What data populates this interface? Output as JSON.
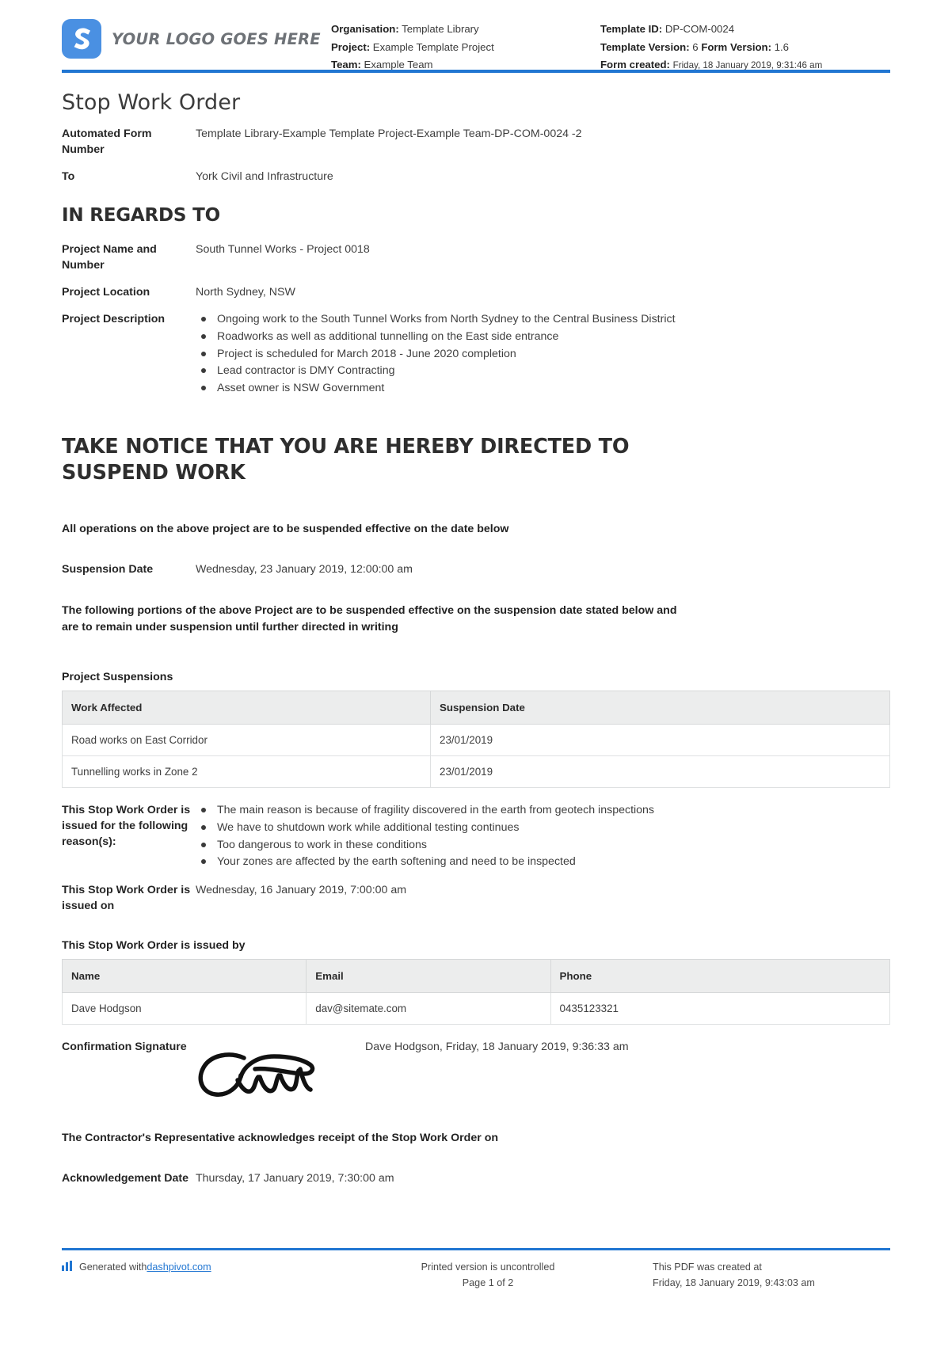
{
  "header": {
    "logo_text": "YOUR LOGO GOES HERE",
    "organisation_label": "Organisation:",
    "organisation_value": "Template Library",
    "project_label": "Project:",
    "project_value": "Example Template Project",
    "team_label": "Team:",
    "team_value": "Example Team",
    "template_id_label": "Template ID:",
    "template_id_value": "DP-COM-0024",
    "template_version_label": "Template Version:",
    "template_version_value": "6",
    "form_version_label": "Form Version:",
    "form_version_value": "1.6",
    "form_created_label": "Form created:",
    "form_created_value": "Friday, 18 January 2019, 9:31:46 am"
  },
  "document": {
    "title": "Stop Work Order",
    "automated_form_number_label": "Automated Form Number",
    "automated_form_number_value": "Template Library-Example Template Project-Example Team-DP-COM-0024   -2",
    "to_label": "To",
    "to_value": "York Civil and Infrastructure"
  },
  "in_regards_to": {
    "heading": "IN REGARDS TO",
    "project_name_label": "Project Name and Number",
    "project_name_value": "South Tunnel Works - Project 0018",
    "project_location_label": "Project Location",
    "project_location_value": "North Sydney, NSW",
    "project_description_label": "Project Description",
    "project_description_items": [
      "Ongoing work to the South Tunnel Works from North Sydney to the Central Business District",
      "Roadworks as well as additional tunnelling on the East side entrance",
      "Project is scheduled for March 2018 - June 2020 completion",
      "Lead contractor is DMY Contracting",
      "Asset owner is NSW Government"
    ]
  },
  "notice": {
    "heading": "TAKE NOTICE THAT YOU ARE HEREBY DIRECTED TO SUSPEND WORK",
    "statement": "All operations on the above project are to be suspended effective on the date below",
    "suspension_date_label": "Suspension Date",
    "suspension_date_value": "Wednesday, 23 January 2019, 12:00:00 am",
    "portions_statement": "The following portions of the above Project are to be suspended effective on the suspension date stated below and are to remain under suspension until further directed in writing"
  },
  "suspensions_table": {
    "caption": "Project Suspensions",
    "columns": [
      "Work Affected",
      "Suspension Date"
    ],
    "rows": [
      [
        "Road works on East Corridor",
        "23/01/2019"
      ],
      [
        "Tunnelling works in Zone 2",
        "23/01/2019"
      ]
    ]
  },
  "reasons": {
    "label": "This Stop Work Order is issued for the following reason(s):",
    "items": [
      "The main reason is because of fragility discovered in the earth from geotech inspections",
      "We have to shutdown work while additional testing continues",
      "Too dangerous to work in these conditions",
      "Your zones are affected by the earth softening and need to be inspected"
    ]
  },
  "issued_on": {
    "label": "This Stop Work Order is issued on",
    "value": "Wednesday, 16 January 2019, 7:00:00 am"
  },
  "issued_by": {
    "caption": "This Stop Work Order is issued by",
    "columns": [
      "Name",
      "Email",
      "Phone"
    ],
    "rows": [
      [
        "Dave Hodgson",
        "dav@sitemate.com",
        "0435123321"
      ]
    ]
  },
  "signature": {
    "label": "Confirmation Signature",
    "signed_by": "Dave Hodgson, Friday, 18 January 2019, 9:36:33 am"
  },
  "acknowledgement": {
    "statement": "The Contractor's Representative acknowledges receipt of the Stop Work Order on",
    "label": "Acknowledgement Date",
    "value": "Thursday, 17 January 2019, 7:30:00 am"
  },
  "footer": {
    "generated_prefix": "Generated with ",
    "generated_link": "dashpivot.com",
    "printed_line1": "Printed version is uncontrolled",
    "printed_line2": "Page 1 of 2",
    "created_line1": "This PDF was created at",
    "created_line2": "Friday, 18 January 2019, 9:43:03 am"
  },
  "colors": {
    "accent_blue": "#2176d2",
    "logo_blue": "#4a90e2",
    "table_header_grey": "#eceded"
  }
}
